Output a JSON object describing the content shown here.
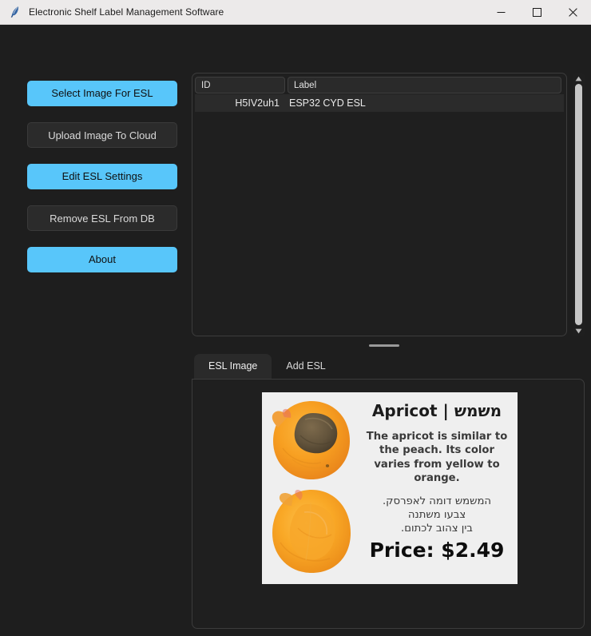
{
  "window": {
    "title": "Electronic Shelf Label Management Software",
    "icon": "python-feather-icon",
    "controls": {
      "minimize": "minimize-icon",
      "maximize": "maximize-icon",
      "close": "close-icon"
    }
  },
  "theme": {
    "accent": "#58c6fa",
    "app_background": "#1e1e1e",
    "panel_background": "#1f1f1f",
    "row_background": "#2b2b2b",
    "border": "#3c3c3c",
    "text": "#e9e9e9",
    "titlebar_background": "#eceaea",
    "scrollbar_thumb": "#c6c6c6"
  },
  "sidebar": {
    "buttons": [
      {
        "label": "Select Image For ESL",
        "style": "accent"
      },
      {
        "label": "Upload Image To Cloud",
        "style": "neutral"
      },
      {
        "label": "Edit ESL Settings",
        "style": "accent"
      },
      {
        "label": "Remove ESL From DB",
        "style": "neutral"
      },
      {
        "label": "About",
        "style": "accent"
      }
    ]
  },
  "esl_table": {
    "columns": [
      "ID",
      "Label"
    ],
    "rows": [
      {
        "id": "H5IV2uh1",
        "label": "ESP32 CYD ESL"
      }
    ],
    "scrollbar": {
      "up_arrow": "chevron-up-icon",
      "down_arrow": "chevron-down-icon",
      "thumb_position_percent": 0,
      "thumb_size_percent": 97
    }
  },
  "splitter": {
    "handle": "sash-grip"
  },
  "notebook": {
    "tabs": [
      {
        "label": "ESL Image",
        "active": true
      },
      {
        "label": "Add ESL",
        "active": false
      }
    ]
  },
  "esl_image": {
    "title": "Apricot | משמש",
    "description_en": "The apricot is similar to the peach. Its color varies from yellow to orange.",
    "description_he_lines": [
      "המשמש דומה לאפרסק.",
      "צבעו משתנה",
      "בין צהוב לכתום."
    ],
    "price": "Price: $2.49",
    "photos": [
      "apricot-half-with-pit-photo",
      "apricot-half-photo"
    ],
    "background": "#efefef"
  }
}
